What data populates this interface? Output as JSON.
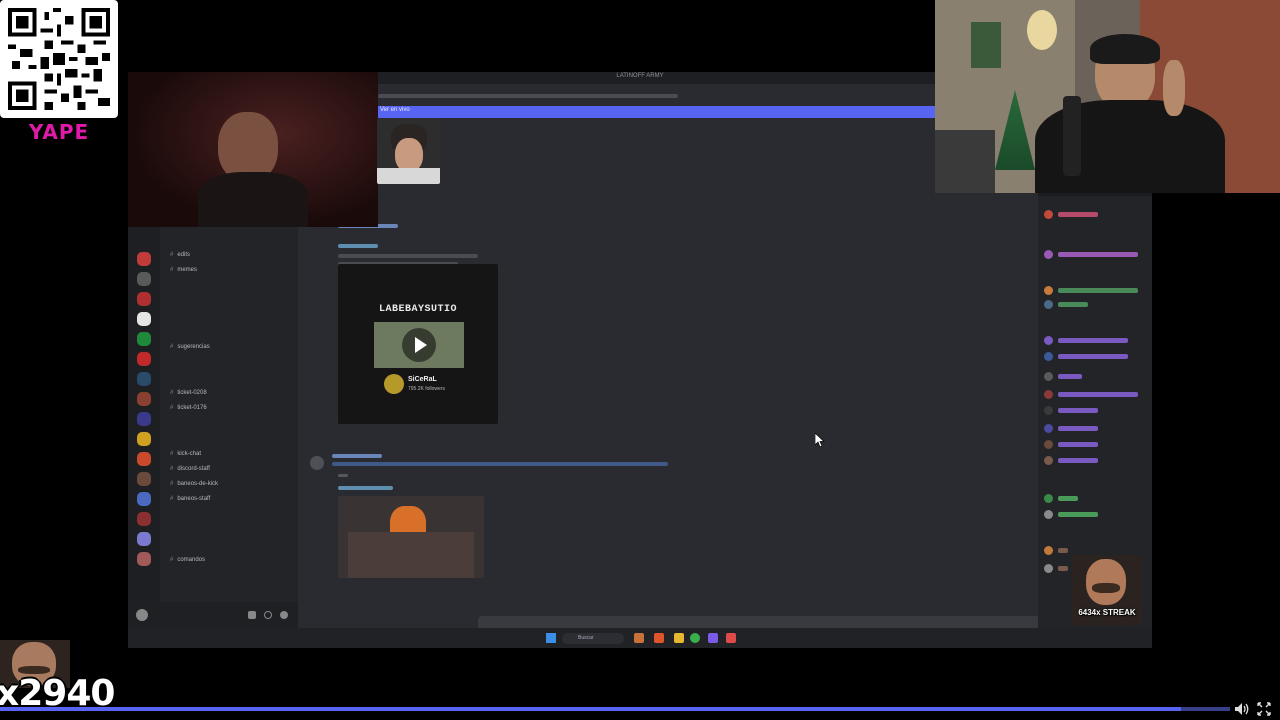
{
  "overlay": {
    "yape_label": "YAPE",
    "counter": "x2940",
    "streak": "6434x STREAK"
  },
  "discord": {
    "window_title": "LATINOFF ARMY",
    "banner_text": "Ver en vivo",
    "channels": [
      {
        "label": "edits"
      },
      {
        "label": "memes"
      },
      {
        "label": "sugerencias"
      },
      {
        "label": "ticket-0208"
      },
      {
        "label": "ticket-0176"
      },
      {
        "label": "kick-chat"
      },
      {
        "label": "discord-staff"
      },
      {
        "label": "baneos-de-kick"
      },
      {
        "label": "baneos-staff"
      },
      {
        "label": "comandos"
      }
    ],
    "video_embed": {
      "title": "LABEBAYSUTIO",
      "channel": "SiCeRaL",
      "subs": "795.2K followers"
    },
    "search_label": "Buscar"
  },
  "player": {
    "progress_fraction": 0.96
  },
  "colors": {
    "accent": "#5865f2",
    "yape": "#e01aa8"
  }
}
